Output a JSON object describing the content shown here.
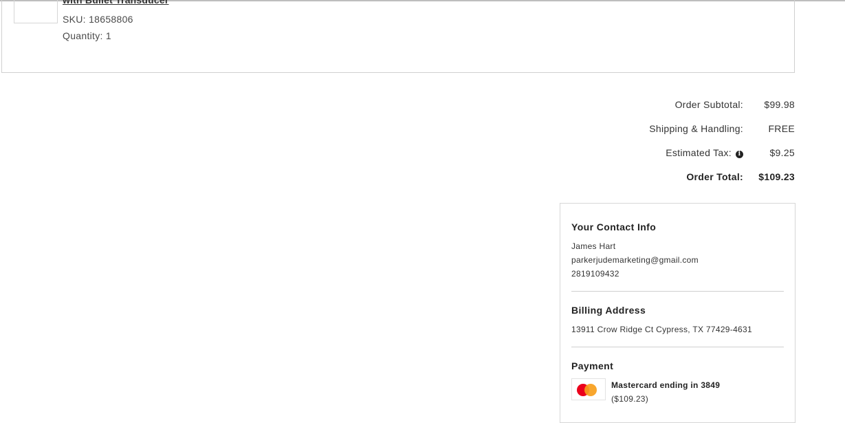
{
  "item": {
    "title": "with Bullet Transducer",
    "sku": "SKU: 18658806",
    "quantity": "Quantity: 1"
  },
  "totals": {
    "subtotal_label": "Order Subtotal:",
    "subtotal_value": "$99.98",
    "shipping_label": "Shipping & Handling:",
    "shipping_value": "FREE",
    "tax_label": "Estimated Tax:",
    "tax_value": "$9.25",
    "total_label": "Order Total:",
    "total_value": "$109.23"
  },
  "contact": {
    "heading": "Your Contact Info",
    "name": "James Hart",
    "email": "parkerjudemarketing@gmail.com",
    "phone": "2819109432"
  },
  "billing": {
    "heading": "Billing Address",
    "address": "13911 Crow Ridge Ct Cypress, TX 77429-4631"
  },
  "payment": {
    "heading": "Payment",
    "card_name": "Mastercard ending in 3849",
    "card_amount": "($109.23)",
    "icon": "mastercard-icon",
    "colors": {
      "red": "#eb001b",
      "yellow": "#f79e1b"
    }
  }
}
